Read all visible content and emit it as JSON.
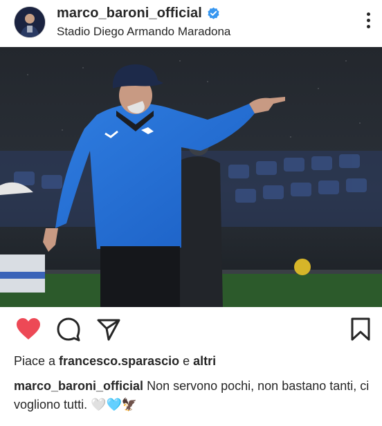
{
  "post": {
    "username": "marco_baroni_official",
    "location": "Stadio Diego Armando Maradona",
    "verified": true,
    "photo_description_icon": "coach-photo",
    "liked": true
  },
  "likes": {
    "prefix": "Piace a ",
    "user": "francesco.sparascio",
    "conjunction": " e ",
    "others": "altri"
  },
  "caption": {
    "user": "marco_baroni_official",
    "text": " Non servono pochi, non bastano tanti, ci vogliono tutti. 🤍🩵🦅"
  },
  "colors": {
    "heart": "#ed4956",
    "verified": "#3897f0",
    "text": "#262626",
    "muted": "#8e8e8e"
  },
  "icons": {
    "more": "more-vertical-icon",
    "like": "heart-icon",
    "comment": "comment-icon",
    "share": "send-icon",
    "save": "bookmark-icon"
  }
}
